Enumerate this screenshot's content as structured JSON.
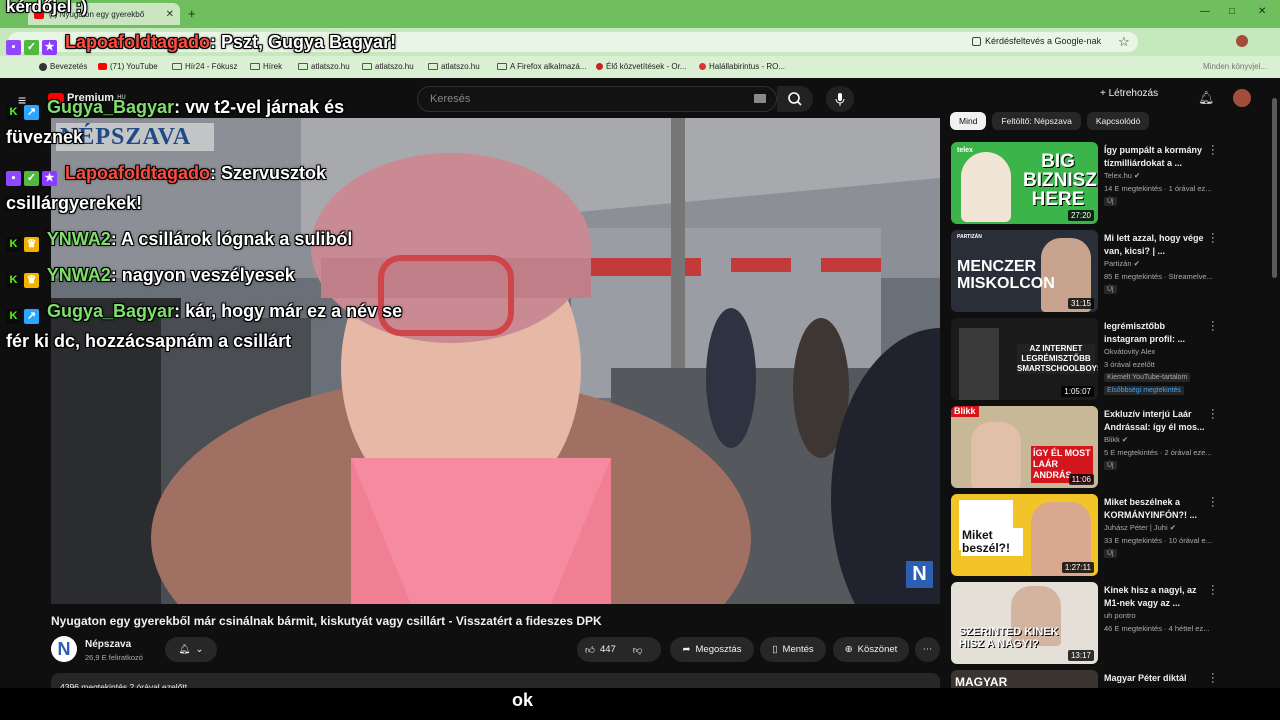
{
  "browser": {
    "tab_title": "(*) Nyugaton egy gyerekbő",
    "tab_close": "✕",
    "new_tab": "+",
    "address_right": "Kérdésfeltevés a Google-nak",
    "bookmarks": [
      "Bevezetés",
      "(71) YouTube",
      "Hír24 - Fókusz",
      "Hírek",
      "atlatszo.hu",
      "atlatszo.hu",
      "atlatszo.hu",
      "A Firefox alkalmazá...",
      "Élő közvetítések - Or...",
      "Halállabirintus - RO..."
    ],
    "bookmark_more": "Minden könyvjel..."
  },
  "youtube": {
    "logo": "Premium",
    "logo_sup": "HU",
    "search_placeholder": "Keresés",
    "create_label": "Létrehozás",
    "video_title": "Nyugaton egy gyerekből már csinálnak bármit, kiskutyát vagy csillárt - Visszatért a fideszes DPK",
    "video_watermark": "NÉPSZAVA",
    "video_logo": "N",
    "channel_name": "Népszava",
    "channel_subs": "26,9 E feliratkozó",
    "channel_avatar": "N",
    "like_count": "447",
    "share_label": "Megosztás",
    "save_label": "Mentés",
    "thanks_label": "Köszönet",
    "more_label": "⋯",
    "description_stats": "4396 megtekintés  2 órával ezelőtt"
  },
  "sidebar": {
    "chips": [
      "Mind",
      "Feltöltő: Népszava",
      "Kapcsolódó"
    ],
    "recommendations": [
      {
        "title": "Így pumpált a kormány tízmilliárdokat a ...",
        "channel": "Telex.hu ✔",
        "meta": "14 E megtekintés · 1 órával ez...",
        "badge": "Új",
        "duration": "27:20",
        "thumb_text": "BIG BIZNISZ HERE",
        "thumb_corner": "telex"
      },
      {
        "title": "Mi lett azzal, hogy vége van, kicsi? | ...",
        "channel": "Partizán ✔",
        "meta": "85 E megtekintés · Streamelve...",
        "badge": "Új",
        "duration": "31:15",
        "thumb_text": "MENCZER MISKOLCON",
        "thumb_corner": "PARTIZÁN"
      },
      {
        "title": "legrémisztőbb instagram profil: ...",
        "channel": "Okvátovity Alex",
        "meta": "3 órával ezelőtt",
        "badge": "Kiemelt YouTube-tartalom",
        "badge2": "Elsőbbségi megtekintés",
        "duration": "1:05:07",
        "thumb_text": "AZ INTERNET LEGRÉMISZTŐBB SMARTSCHOOLBOYS"
      },
      {
        "title": "Exkluzív interjú Laár Andrással: így él mos...",
        "channel": "Blikk ✔",
        "meta": "5 E megtekintés · 2 órával eze...",
        "badge": "Új",
        "duration": "11:06",
        "thumb_text": "ÍGY ÉL MOST LAÁR ANDRÁS",
        "thumb_corner": "Blikk"
      },
      {
        "title": "Miket beszélnek a KORMÁNYINFÓN?! ...",
        "channel": "Juhász Péter | Juhi ✔",
        "meta": "33 E megtekintés · 10 órával e...",
        "badge": "Új",
        "duration": "1:27:11",
        "thumb_text": "Miket beszél?!"
      },
      {
        "title": "Kinek hisz a nagyi, az M1-nek vagy az ...",
        "channel": "uh pontro",
        "meta": "46 E megtekintés · 4 héttel ez...",
        "badge": "",
        "duration": "13:17",
        "thumb_text": "SZERINTED KINEK HISZ A NAGYI?"
      },
      {
        "title": "Magyar Péter diktál",
        "channel": "",
        "meta": "",
        "badge": "",
        "duration": "",
        "thumb_text": "MAGYAR"
      }
    ]
  },
  "chat": [
    {
      "user": "kérdőjel :)",
      "text": "",
      "color": "#ffffff"
    },
    {
      "user": "Lapoafoldtagado",
      "text": ": Pszt, Gugya Bagyar!",
      "color": "#ff4b3e"
    },
    {
      "user": "Gugya_Bagyar",
      "text": ": vw t2-vel járnak és",
      "color": "#7ee06a"
    },
    {
      "user": "",
      "text": "füveznek",
      "color": "#ffffff"
    },
    {
      "user": "Lapoafoldtagado",
      "text": ": Szervusztok",
      "color": "#ff4b3e"
    },
    {
      "user": "",
      "text": "csillárgyerekek!",
      "color": "#ffffff"
    },
    {
      "user": "YNWA2",
      "text": ": A csillárok lógnak a suliból",
      "color": "#7ee06a"
    },
    {
      "user": "YNWA2",
      "text": ": nagyon veszélyesek",
      "color": "#7ee06a"
    },
    {
      "user": "Gugya_Bagyar",
      "text": ": kár, hogy már ez a név se",
      "color": "#7ee06a"
    },
    {
      "user": "",
      "text": "fér ki dc, hozzácsapnám a csillárt",
      "color": "#ffffff"
    }
  ],
  "subtitle": "ok",
  "colors": {
    "chrome_green": "#6fbf5e",
    "yt_bg": "#0f0f0f",
    "twitch": "#9146ff",
    "kick": "#53fc18"
  }
}
